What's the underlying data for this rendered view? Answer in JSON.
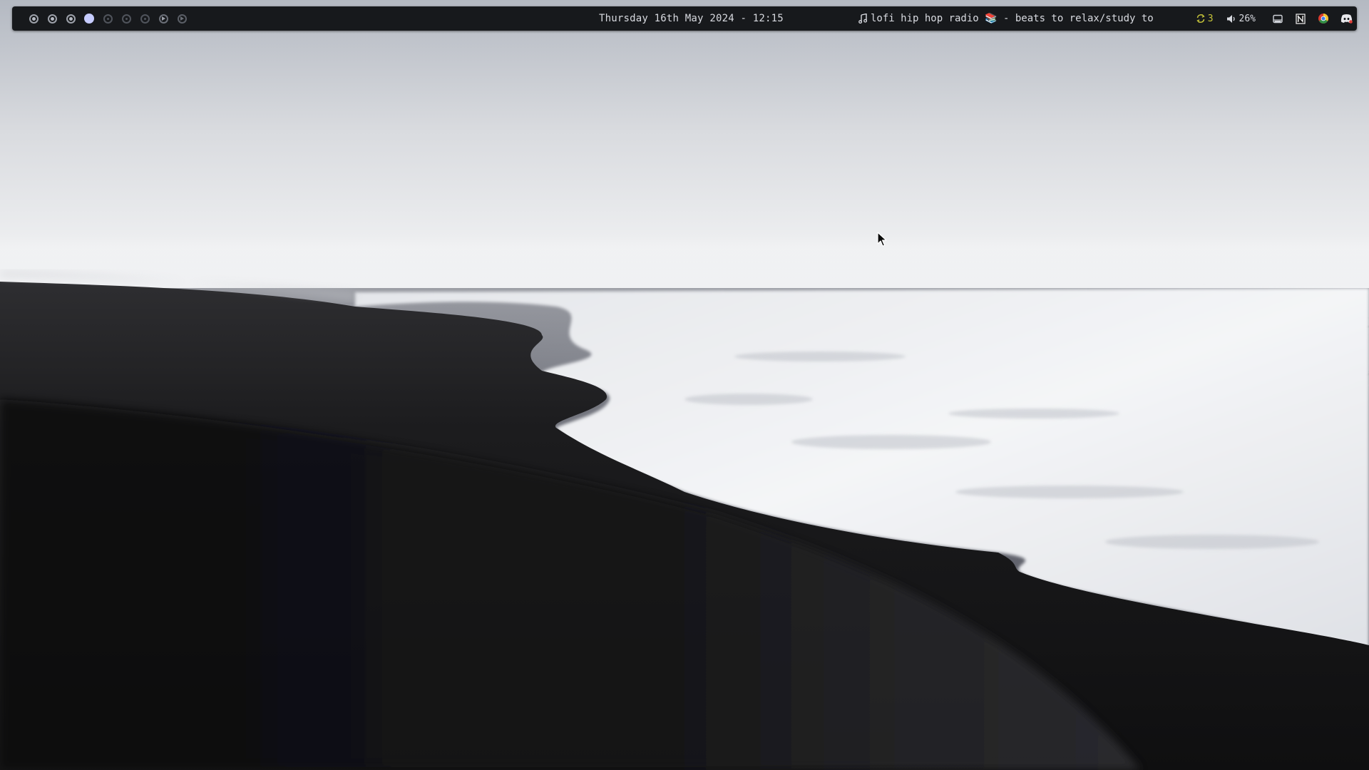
{
  "bar": {
    "workspaces": [
      {
        "name": "workspace-1",
        "state": "occupied"
      },
      {
        "name": "workspace-2",
        "state": "occupied"
      },
      {
        "name": "workspace-3",
        "state": "occupied"
      },
      {
        "name": "workspace-4",
        "state": "active"
      },
      {
        "name": "workspace-5",
        "state": "empty"
      },
      {
        "name": "workspace-6",
        "state": "empty"
      },
      {
        "name": "workspace-7",
        "state": "empty"
      },
      {
        "name": "workspace-8",
        "state": "arrow"
      },
      {
        "name": "workspace-9",
        "state": "arrow-empty"
      }
    ],
    "clock": "Thursday 16th May 2024 - 12:15",
    "media": {
      "icon": "music-note-icon",
      "title": "lofi hip hop radio 📚 - beats to relax/study to"
    },
    "updates": {
      "icon": "refresh-icon",
      "count": "3",
      "color": "#c6c43a"
    },
    "volume": {
      "icon": "speaker-icon",
      "level": "26%",
      "value": 0.26
    },
    "tray": [
      {
        "name": "tray-drive-icon"
      },
      {
        "name": "tray-notion-icon"
      },
      {
        "name": "tray-chrome-icon"
      },
      {
        "name": "tray-discord-icon"
      }
    ],
    "colors": {
      "bar_bg": "#17191c",
      "text": "#d8dae0",
      "active_workspace": "#c6ccff",
      "updates": "#c6c43a"
    }
  },
  "wallpaper": {
    "subject": "black-sand-beach-fog-wallpaper"
  }
}
